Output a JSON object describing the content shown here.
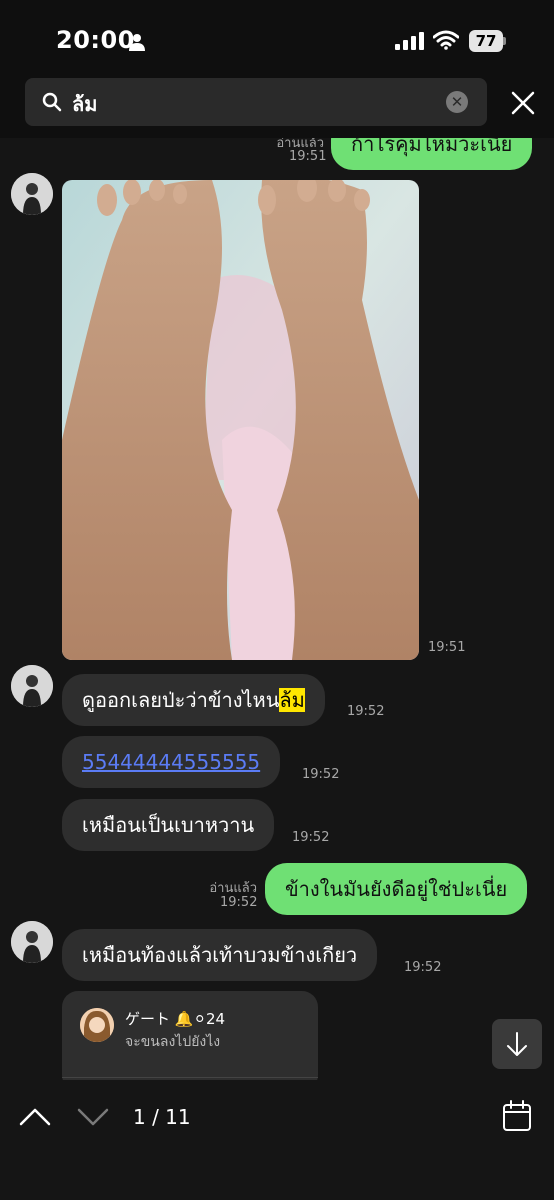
{
  "status": {
    "time": "20:00",
    "battery": "77"
  },
  "search": {
    "query": "ล้ม"
  },
  "messages": {
    "top_read": "อ่านแล้ว",
    "top_time": "19:51",
    "top_text": "ก้าไรคุมไหมวะเนี่ย",
    "photo_time": "19:51",
    "m1_prefix": "ดูออกเลยป่ะว่าข้างไหน",
    "m1_highlight": "ล้ม",
    "m1_time": "19:52",
    "m2_text": "55444444555555",
    "m2_time": "19:52",
    "m3_text": "เหมือนเป็นเบาหวาน",
    "m3_time": "19:52",
    "out_read": "อ่านแล้ว",
    "out_time": "19:52",
    "out_text": "ข้างในมันยังดีอยู่ใช่ปะเนี่ย",
    "m4_text": "เหมือนท้องแล้วเท้าบวมข้างเกียว",
    "m4_time": "19:52",
    "reply_name": "ゲート 🔔⚪24",
    "reply_text": "จะขนลงไปยังไง"
  },
  "nav": {
    "counter": "1 / 11"
  }
}
